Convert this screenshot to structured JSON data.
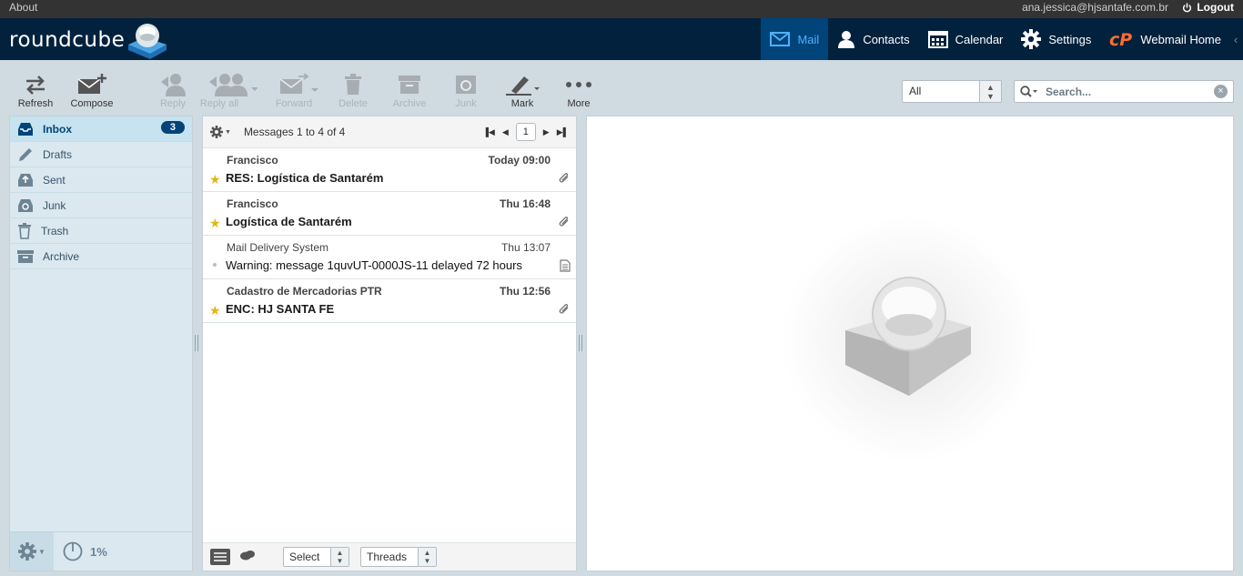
{
  "topline": {
    "about": "About",
    "user": "ana.jessica@hjsantafe.com.br",
    "logout": "Logout"
  },
  "logo": {
    "text": "roundcube"
  },
  "nav": [
    {
      "label": "Mail",
      "icon": "mail-icon",
      "active": true
    },
    {
      "label": "Contacts",
      "icon": "contacts-icon"
    },
    {
      "label": "Calendar",
      "icon": "calendar-icon"
    },
    {
      "label": "Settings",
      "icon": "gear-icon"
    },
    {
      "label": "Webmail Home",
      "icon": "cpanel-icon"
    }
  ],
  "toolbar": {
    "refresh": "Refresh",
    "compose": "Compose",
    "reply": "Reply",
    "reply_all": "Reply all",
    "forward": "Forward",
    "delete": "Delete",
    "archive": "Archive",
    "junk": "Junk",
    "mark": "Mark",
    "more": "More"
  },
  "filter": {
    "value": "All"
  },
  "search": {
    "placeholder": "Search..."
  },
  "folders": [
    {
      "label": "Inbox",
      "icon": "inbox-icon",
      "unread": "3",
      "selected": true
    },
    {
      "label": "Drafts",
      "icon": "pencil-icon"
    },
    {
      "label": "Sent",
      "icon": "sent-icon"
    },
    {
      "label": "Junk",
      "icon": "junk-icon"
    },
    {
      "label": "Trash",
      "icon": "trash-icon"
    },
    {
      "label": "Archive",
      "icon": "archive-icon"
    }
  ],
  "quota": "1%",
  "list": {
    "count_text": "Messages 1 to 4 of 4",
    "page": "1",
    "messages": [
      {
        "from": "Francisco",
        "date": "Today 09:00",
        "subject": "RES: Logística de Santarém",
        "unread": true,
        "flagged": true,
        "attachment": true
      },
      {
        "from": "Francisco",
        "date": "Thu 16:48",
        "subject": "Logística de Santarém",
        "unread": true,
        "flagged": true,
        "attachment": true
      },
      {
        "from": "Mail Delivery System",
        "date": "Thu 13:07",
        "subject": "Warning: message 1quvUT-0000JS-11 delayed 72 hours",
        "unread": false,
        "flagged": false,
        "attachment": false
      },
      {
        "from": "Cadastro de Mercadorias PTR",
        "date": "Thu 12:56",
        "subject": "ENC: HJ SANTA FE",
        "unread": true,
        "flagged": true,
        "attachment": true
      }
    ],
    "footer": {
      "select": "Select",
      "threads": "Threads"
    }
  },
  "colors": {
    "header": "#01213d",
    "accent": "#004479",
    "active_nav_text": "#4fb0ff",
    "flag": "#e2b70d",
    "cpanel": "#ff6c2c"
  }
}
